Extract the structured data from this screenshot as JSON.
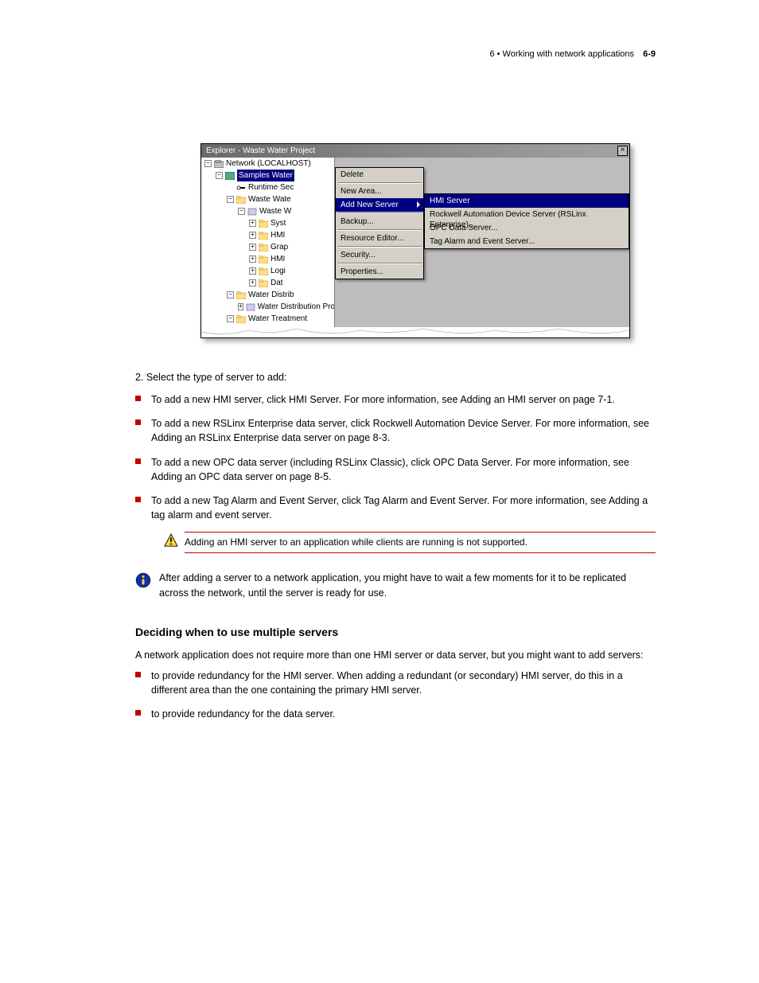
{
  "header": {
    "chapter_label": "6 • Working with network applications",
    "page_num": "6-9"
  },
  "shot": {
    "title": "Explorer - Waste Water Project",
    "tree": {
      "root": "Network (LOCALHOST)",
      "app": "Samples Water",
      "runtime": "Runtime Sec",
      "area1": "Waste Wate",
      "area1_sub": "Waste W",
      "folder1": "Syst",
      "folder2": "HMI",
      "folder3": "Grap",
      "folder4": "HMI",
      "folder5": "Logi",
      "folder6": "Dat",
      "area2": "Water Distrib",
      "area2_sub": "Water Distribution Project",
      "area3": "Water Treatment"
    },
    "context_menu": {
      "items": [
        "Delete",
        "New Area...",
        "Add New Server",
        "Backup...",
        "Resource Editor...",
        "Security...",
        "Properties..."
      ]
    },
    "sub_menu": {
      "items": [
        "HMI Server",
        "Rockwell Automation Device Server (RSLinx Enterprise)...",
        "OPC Data Server...",
        "Tag Alarm and Event Server..."
      ]
    }
  },
  "lead": "2.   Select the type of server to add:",
  "bullets": [
    "To add a new HMI server, click HMI Server. For more information, see Adding an HMI server on page 7-1.",
    "To add a new RSLinx Enterprise data server, click Rockwell Automation Device Server. For more information, see Adding an RSLinx Enterprise data server on page 8-3.",
    "To add a new OPC data server (including RSLinx Classic), click OPC Data Server. For more information, see Adding an OPC data server on page 8-5.",
    "To add a new Tag Alarm and Event Server, click Tag Alarm and Event Server. For more information, see Adding a tag alarm and event server."
  ],
  "warning": "Adding an HMI server to an application while clients are running is not supported.",
  "info": "After adding a server to a network application, you might have to wait a few moments for it to be replicated across the network, until the server is ready for use.",
  "section_title": "Deciding when to use multiple servers",
  "section_para": "A network application does not require more than one HMI server or data server, but you might want to add servers:",
  "steps": [
    "to provide redundancy for the HMI server. When adding a redundant (or secondary) HMI server, do this in a different area than the one containing the primary HMI server.",
    "to provide redundancy for the data server."
  ]
}
